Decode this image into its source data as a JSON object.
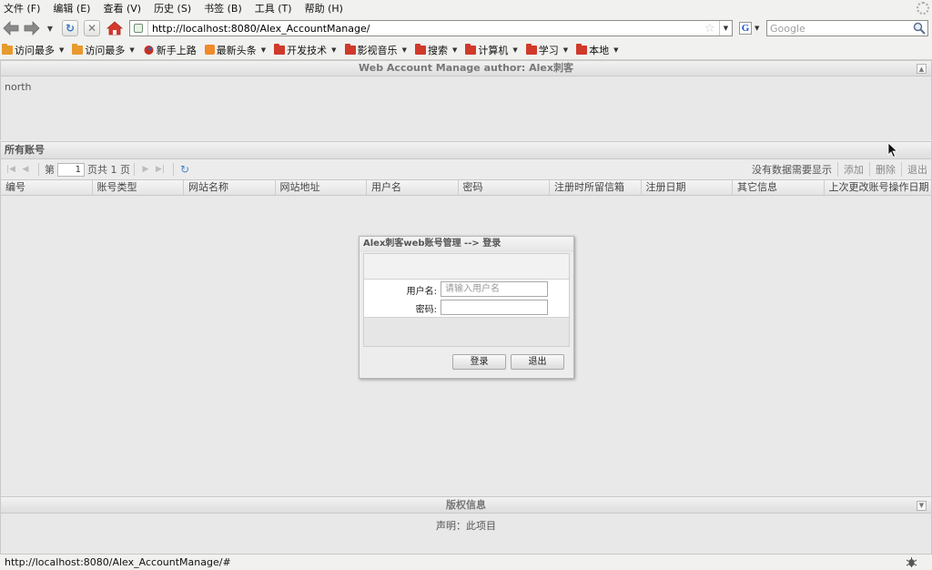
{
  "menubar": {
    "items": [
      "文件 (F)",
      "编辑 (E)",
      "查看 (V)",
      "历史 (S)",
      "书签 (B)",
      "工具 (T)",
      "帮助 (H)"
    ]
  },
  "navbar": {
    "url": "http://localhost:8080/Alex_AccountManage/",
    "search_placeholder": "Google",
    "search_engine_letter": "G"
  },
  "bookmarks": [
    {
      "label": "访问最多",
      "icon": "folder-orange",
      "caret": true
    },
    {
      "label": "访问最多",
      "icon": "folder-orange",
      "caret": true
    },
    {
      "label": "新手上路",
      "icon": "firefox-icon",
      "caret": false
    },
    {
      "label": "最新头条",
      "icon": "rss",
      "caret": true
    },
    {
      "label": "开发技术",
      "icon": "folder-red",
      "caret": true
    },
    {
      "label": "影视音乐",
      "icon": "folder-red",
      "caret": true
    },
    {
      "label": "搜索",
      "icon": "folder-red",
      "caret": true
    },
    {
      "label": "计算机",
      "icon": "folder-red",
      "caret": true
    },
    {
      "label": "学习",
      "icon": "folder-red",
      "caret": true
    },
    {
      "label": "本地",
      "icon": "folder-red",
      "caret": true
    }
  ],
  "app": {
    "north_title": "Web Account Manage author: Alex刺客",
    "north_body": "north",
    "center_title": "所有账号",
    "pager": {
      "page_prefix": "第",
      "page_value": "1",
      "page_suffix": "页共 1 页",
      "empty_msg": "没有数据需要显示",
      "add": "添加",
      "delete": "删除",
      "exit": "退出"
    },
    "columns": [
      "编号",
      "账号类型",
      "网站名称",
      "网站地址",
      "用户名",
      "密码",
      "注册时所留信箱",
      "注册日期",
      "其它信息",
      "上次更改账号操作日期"
    ],
    "south_title": "版权信息",
    "south_body": "声明：此项目"
  },
  "dialog": {
    "title": "Alex刺客web账号管理 --> 登录",
    "username_label": "用户名:",
    "username_placeholder": "请输入用户名",
    "password_label": "密码:",
    "login_button": "登录",
    "exit_button": "退出"
  },
  "statusbar": {
    "text": "http://localhost:8080/Alex_AccountManage/#"
  }
}
